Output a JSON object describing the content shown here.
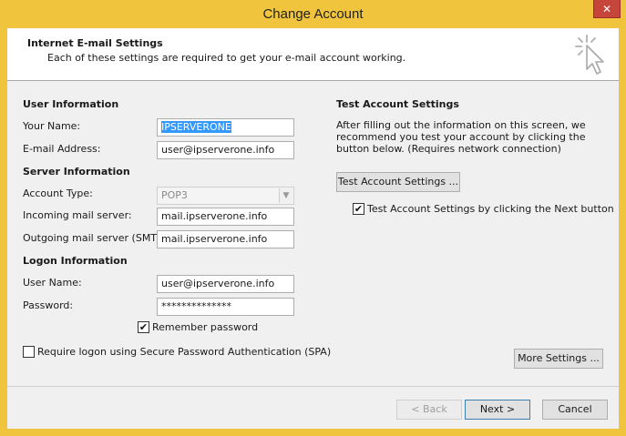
{
  "window": {
    "title": "Change Account",
    "close_glyph": "✕"
  },
  "header": {
    "title": "Internet E-mail Settings",
    "subtitle": "Each of these settings are required to get your e-mail account working."
  },
  "user_info": {
    "heading": "User Information",
    "name_label": "Your Name:",
    "name_value": "IPSERVERONE",
    "email_label": "E-mail Address:",
    "email_value": "user@ipserverone.info"
  },
  "server_info": {
    "heading": "Server Information",
    "account_type_label": "Account Type:",
    "account_type_value": "POP3",
    "incoming_label": "Incoming mail server:",
    "incoming_value": "mail.ipserverone.info",
    "outgoing_label": "Outgoing mail server (SMTP):",
    "outgoing_value": "mail.ipserverone.info"
  },
  "logon_info": {
    "heading": "Logon Information",
    "username_label": "User Name:",
    "username_value": "user@ipserverone.info",
    "password_label": "Password:",
    "password_value": "**************",
    "remember_label": "Remember password",
    "remember_checked": true,
    "spa_label": "Require logon using Secure Password Authentication (SPA)",
    "spa_checked": false
  },
  "test_settings": {
    "heading": "Test Account Settings",
    "description": "After filling out the information on this screen, we recommend you test your account by clicking the button below. (Requires network connection)",
    "test_button": "Test Account Settings ...",
    "auto_test_label": "Test Account Settings by clicking the Next button",
    "auto_test_checked": true
  },
  "buttons": {
    "more_settings": "More Settings ...",
    "back": "< Back",
    "next": "Next >",
    "cancel": "Cancel"
  },
  "colors": {
    "title_bar": "#f0c43c",
    "selection": "#3399ff",
    "dialog_bg": "#f0f0f0"
  }
}
